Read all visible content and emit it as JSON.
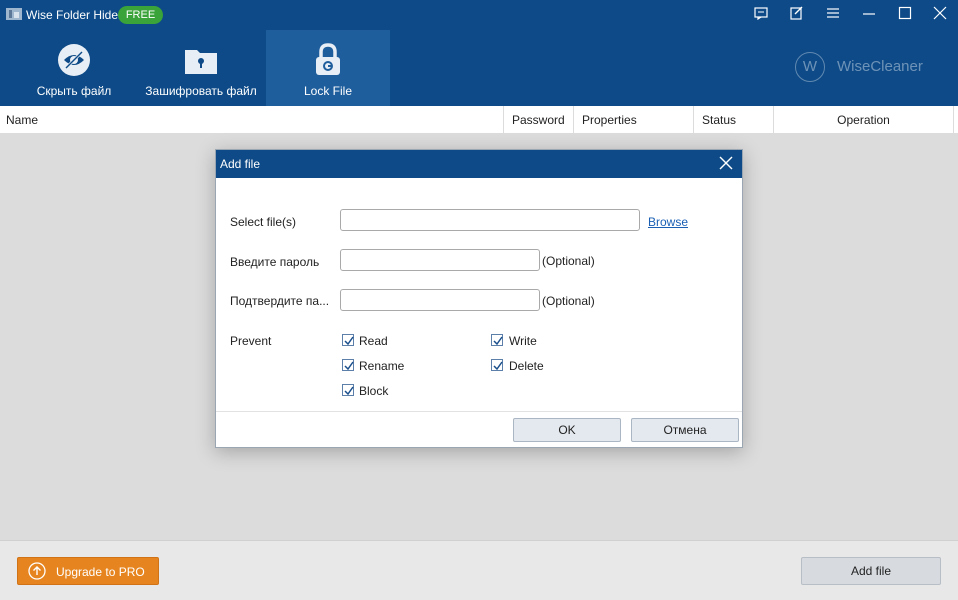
{
  "window": {
    "title": "Wise Folder Hider",
    "badge": "FREE"
  },
  "nav": {
    "items": [
      {
        "label": "Скрыть файл",
        "icon": "eye-slash-icon"
      },
      {
        "label": "Зашифровать файл",
        "icon": "folder-lock-icon"
      },
      {
        "label": "Lock File",
        "icon": "lock-icon",
        "active": true
      }
    ]
  },
  "brand": {
    "text": "WiseCleaner",
    "letter": "W"
  },
  "table": {
    "columns": [
      "Name",
      "Password",
      "Properties",
      "Status",
      "Operation"
    ]
  },
  "footer": {
    "upgrade_label": "Upgrade to PRO",
    "add_file_label": "Add file"
  },
  "dialog": {
    "title": "Add file",
    "select_label": "Select file(s)",
    "select_value": "",
    "browse_label": "Browse",
    "password_label": "Введите пароль",
    "password_value": "",
    "confirm_label": "Подтвердите па...",
    "confirm_value": "",
    "optional_text": "(Optional)",
    "prevent_label": "Prevent",
    "options": {
      "read": {
        "label": "Read",
        "checked": true
      },
      "write": {
        "label": "Write",
        "checked": true
      },
      "rename": {
        "label": "Rename",
        "checked": true
      },
      "delete": {
        "label": "Delete",
        "checked": true
      },
      "block": {
        "label": "Block",
        "checked": true
      }
    },
    "ok_label": "OK",
    "cancel_label": "Отмена"
  },
  "colors": {
    "header_bg": "#0d4a87",
    "active_tab_bg": "#1f5e9d",
    "badge_green": "#3aa33a",
    "upgrade_orange": "#e6851f",
    "link_blue": "#1a5fb4"
  }
}
